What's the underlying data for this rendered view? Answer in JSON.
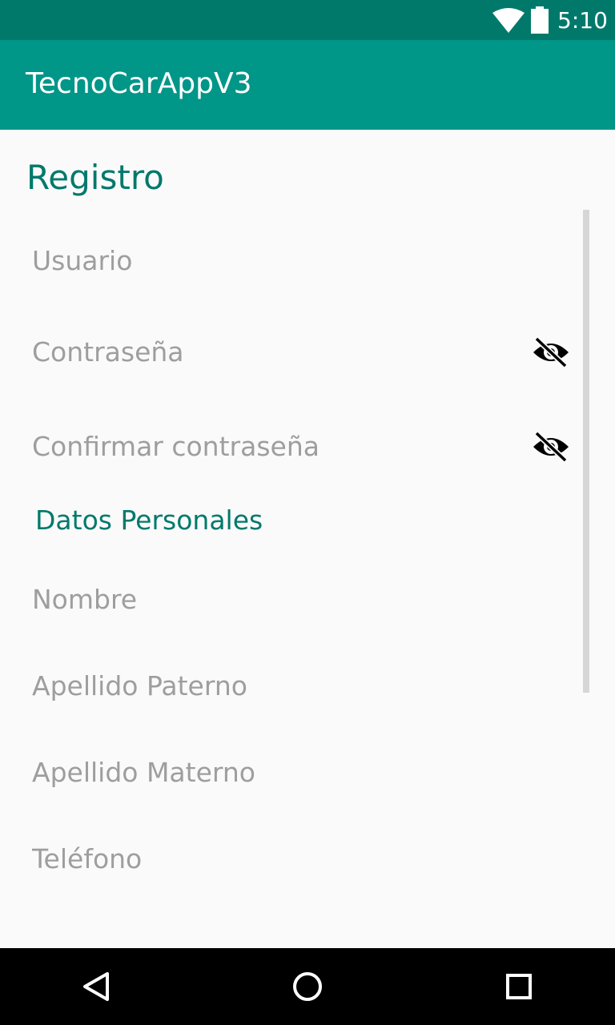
{
  "status_bar": {
    "time": "5:10",
    "icons": [
      "wifi-icon",
      "battery-icon"
    ]
  },
  "app_bar": {
    "title": "TecnoCarAppV3"
  },
  "screen": {
    "title": "Registro"
  },
  "form": {
    "usuario": {
      "placeholder": "Usuario",
      "value": ""
    },
    "contrasena": {
      "placeholder": "Contraseña",
      "value": "",
      "toggle_icon": "eye-off-icon"
    },
    "confirmar": {
      "placeholder": "Confirmar contraseña",
      "value": "",
      "toggle_icon": "eye-off-icon"
    },
    "section_title": "Datos Personales",
    "nombre": {
      "placeholder": "Nombre",
      "value": ""
    },
    "apellido_paterno": {
      "placeholder": "Apellido Paterno",
      "value": ""
    },
    "apellido_materno": {
      "placeholder": "Apellido Materno",
      "value": ""
    },
    "telefono": {
      "placeholder": "Teléfono",
      "value": ""
    }
  },
  "nav_bar": {
    "buttons": [
      "back-icon",
      "home-icon",
      "recents-icon"
    ]
  },
  "colors": {
    "status_bar": "#00796B",
    "app_bar": "#009688",
    "accent_text": "#00796B",
    "background": "#FAFAFA",
    "hint_text": "#9E9E9E",
    "nav_bar": "#000000",
    "scrollbar": "#D6D6D6"
  }
}
